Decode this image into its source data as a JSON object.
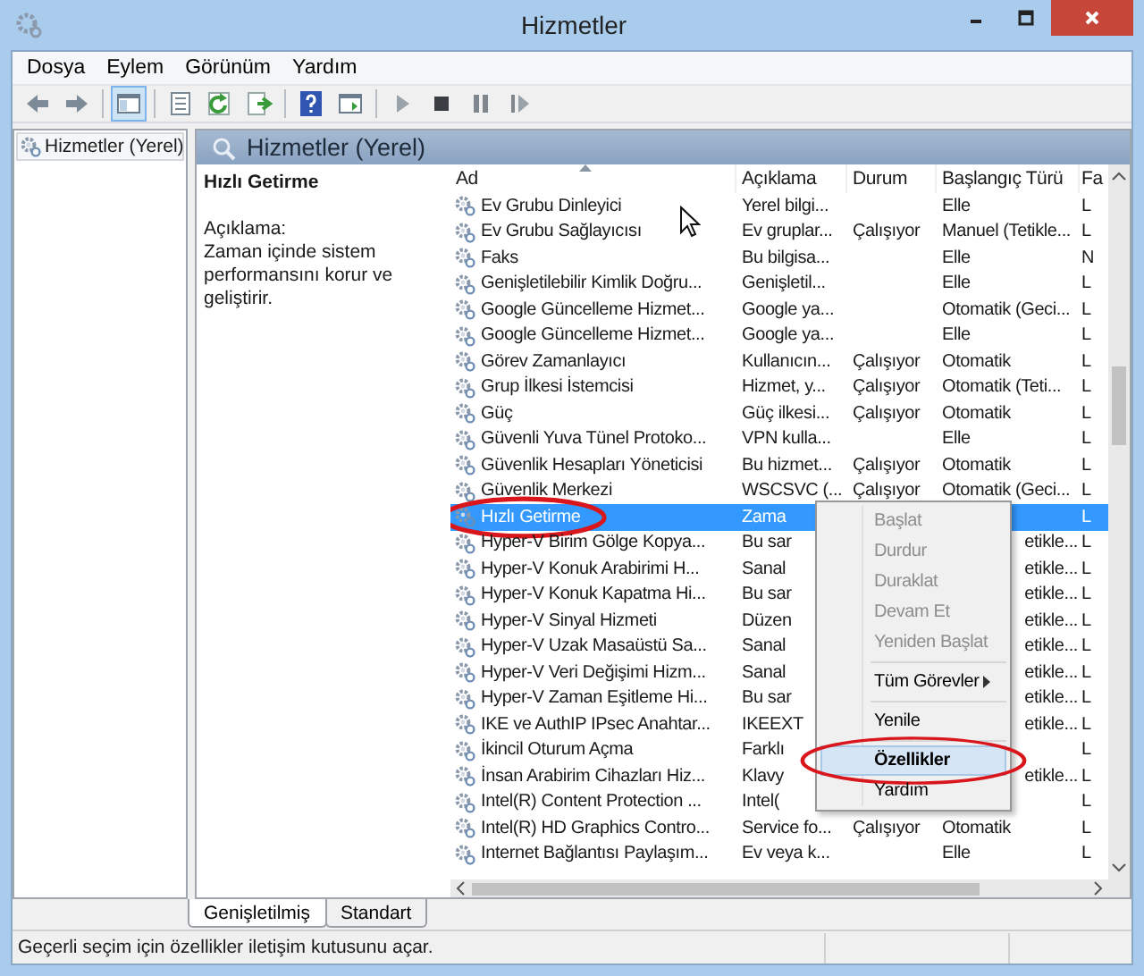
{
  "window": {
    "title": "Hizmetler"
  },
  "menu_bar": [
    "Dosya",
    "Eylem",
    "Görünüm",
    "Yardım"
  ],
  "toolbar": [
    {
      "kind": "back",
      "selected": false
    },
    {
      "kind": "forward",
      "selected": false
    },
    {
      "kind": "separator"
    },
    {
      "kind": "tree",
      "selected": true
    },
    {
      "kind": "separator"
    },
    {
      "kind": "properties",
      "selected": false
    },
    {
      "kind": "refresh",
      "selected": false
    },
    {
      "kind": "export",
      "selected": false
    },
    {
      "kind": "separator"
    },
    {
      "kind": "help",
      "selected": false
    },
    {
      "kind": "action",
      "selected": false
    },
    {
      "kind": "separator"
    },
    {
      "kind": "play",
      "selected": false
    },
    {
      "kind": "stop",
      "selected": false
    },
    {
      "kind": "pause",
      "selected": false
    },
    {
      "kind": "resume",
      "selected": false
    }
  ],
  "tree": [
    {
      "label": "Hizmetler (Yerel)",
      "selected": true
    }
  ],
  "panel": {
    "title": "Hizmetler (Yerel)",
    "service_name": "Hızlı Getirme",
    "description_label": "Açıklama:",
    "description": "Zaman içinde sistem performansını korur ve geliştirir."
  },
  "list": {
    "columns": [
      {
        "label": "Ad",
        "sorted": true
      },
      {
        "label": "Açıklama",
        "sorted": false
      },
      {
        "label": "Durum",
        "sorted": false
      },
      {
        "label": "Başlangıç Türü",
        "sorted": false
      },
      {
        "label": "Fa",
        "sorted": false
      }
    ],
    "rows": [
      {
        "kind": "plain",
        "name": "Ev Grubu Dinleyici",
        "description": "Yerel bilgi...",
        "startup": "Elle",
        "column_5": "L",
        "selected": false,
        "circled": false
      },
      {
        "kind": "plain",
        "name": "Ev Grubu Sağlayıcısı",
        "description": "Ev gruplar...",
        "status": "Çalışıyor",
        "startup": "Manuel (Tetikle...",
        "column_5": "L",
        "selected": false,
        "circled": false
      },
      {
        "kind": "plain",
        "name": "Faks",
        "description": "Bu bilgisa...",
        "startup": "Elle",
        "column_5": "N",
        "selected": false,
        "circled": false
      },
      {
        "kind": "plain",
        "name": "Genişletilebilir Kimlik Doğru...",
        "description": "Genişletil...",
        "startup": "Elle",
        "column_5": "L",
        "selected": false,
        "circled": false
      },
      {
        "kind": "plain",
        "name": "Google Güncelleme Hizmet...",
        "description": "Google ya...",
        "startup": "Otomatik (Geci...",
        "column_5": "L",
        "selected": false,
        "circled": false
      },
      {
        "kind": "plain",
        "name": "Google Güncelleme Hizmet...",
        "description": "Google ya...",
        "startup": "Elle",
        "column_5": "L",
        "selected": false,
        "circled": false
      },
      {
        "kind": "plain",
        "name": "Görev Zamanlayıcı",
        "description": "Kullanıcın...",
        "status": "Çalışıyor",
        "startup": "Otomatik",
        "column_5": "L",
        "selected": false,
        "circled": false
      },
      {
        "kind": "plain",
        "name": "Grup İlkesi İstemcisi",
        "description": "Hizmet, y...",
        "status": "Çalışıyor",
        "startup": "Otomatik (Teti...",
        "column_5": "L",
        "selected": false,
        "circled": false
      },
      {
        "kind": "plain",
        "name": "Güç",
        "description": "Güç ilkesi...",
        "status": "Çalışıyor",
        "startup": "Otomatik",
        "column_5": "L",
        "selected": false,
        "circled": false
      },
      {
        "kind": "plain",
        "name": "Güvenli Yuva Tünel Protoko...",
        "description": "VPN kulla...",
        "startup": "Elle",
        "column_5": "L",
        "selected": false,
        "circled": false
      },
      {
        "kind": "plain",
        "name": "Güvenlik Hesapları Yöneticisi",
        "description": "Bu hizmet...",
        "status": "Çalışıyor",
        "startup": "Otomatik",
        "column_5": "L",
        "selected": false,
        "circled": false
      },
      {
        "kind": "plain",
        "name": "Güvenlik Merkezi",
        "description": "WSCSVC (...",
        "status": "Çalışıyor",
        "startup": "Otomatik (Geci...",
        "column_5": "L",
        "selected": false,
        "circled": false
      },
      {
        "kind": "covered",
        "name": "Hızlı Getirme",
        "description": "Zama",
        "column_5": "L",
        "selected": true,
        "circled": true
      },
      {
        "kind": "covered",
        "name": "Hyper-V Birim Gölge Kopya...",
        "description": "Bu sar",
        "startup": "etikle...",
        "column_5": "L",
        "selected": false,
        "circled": false
      },
      {
        "kind": "covered",
        "name": "Hyper-V Konuk Arabirimi H...",
        "description": "Sanal",
        "startup": "etikle...",
        "column_5": "L",
        "selected": false,
        "circled": false
      },
      {
        "kind": "covered",
        "name": "Hyper-V Konuk Kapatma Hi...",
        "description": "Bu sar",
        "startup": "etikle...",
        "column_5": "L",
        "selected": false,
        "circled": false
      },
      {
        "kind": "covered",
        "name": "Hyper-V Sinyal Hizmeti",
        "description": "Düzen",
        "startup": "etikle...",
        "column_5": "L",
        "selected": false,
        "circled": false
      },
      {
        "kind": "covered",
        "name": "Hyper-V Uzak Masaüstü Sa...",
        "description": "Sanal",
        "startup": "etikle...",
        "column_5": "L",
        "selected": false,
        "circled": false
      },
      {
        "kind": "covered",
        "name": "Hyper-V Veri Değişimi Hizm...",
        "description": "Sanal",
        "startup": "etikle...",
        "column_5": "L",
        "selected": false,
        "circled": false
      },
      {
        "kind": "covered",
        "name": "Hyper-V Zaman Eşitleme Hi...",
        "description": "Bu sar",
        "startup": "etikle...",
        "column_5": "L",
        "selected": false,
        "circled": false
      },
      {
        "kind": "covered",
        "name": "IKE ve AuthIP IPsec Anahtar...",
        "description": "IKEEXT",
        "startup": "etikle...",
        "column_5": "L",
        "selected": false,
        "circled": false
      },
      {
        "kind": "covered",
        "name": "İkincil Oturum Açma",
        "description": "Farklı",
        "column_5": "L",
        "selected": false,
        "circled": false
      },
      {
        "kind": "covered",
        "name": "İnsan Arabirim Cihazları Hiz...",
        "description": "Klavy",
        "startup": "etikle...",
        "column_5": "L",
        "selected": false,
        "circled": false
      },
      {
        "kind": "covered",
        "name": "Intel(R) Content Protection ...",
        "description": "Intel(",
        "column_5": "L",
        "selected": false,
        "circled": false
      },
      {
        "kind": "plain",
        "name": "Intel(R) HD Graphics Contro...",
        "description": "Service fo...",
        "status": "Çalışıyor",
        "startup": "Otomatik",
        "column_5": "L",
        "selected": false,
        "circled": false
      },
      {
        "kind": "plain",
        "name": "Internet Bağlantısı Paylaşım...",
        "description": "Ev veya k...",
        "startup": "Elle",
        "column_5": "L",
        "selected": false,
        "circled": false
      }
    ]
  },
  "context_menu": [
    {
      "kind": "item",
      "label": "Başlat",
      "disabled": true,
      "selected": false,
      "circled": false
    },
    {
      "kind": "item",
      "label": "Durdur",
      "disabled": true,
      "selected": false,
      "circled": false
    },
    {
      "kind": "item",
      "label": "Duraklat",
      "disabled": true,
      "selected": false,
      "circled": false
    },
    {
      "kind": "item",
      "label": "Devam Et",
      "disabled": true,
      "selected": false,
      "circled": false
    },
    {
      "kind": "item",
      "label": "Yeniden Başlat",
      "disabled": true,
      "selected": false,
      "circled": false
    },
    {
      "kind": "separator"
    },
    {
      "kind": "submenu",
      "label": "Tüm Görevler",
      "disabled": false,
      "selected": false,
      "circled": false
    },
    {
      "kind": "separator"
    },
    {
      "kind": "item",
      "label": "Yenile",
      "disabled": false,
      "selected": false,
      "circled": false
    },
    {
      "kind": "separator"
    },
    {
      "kind": "item",
      "label": "Özellikler",
      "disabled": false,
      "selected": true,
      "circled": true
    },
    {
      "kind": "item",
      "label": "Yardım",
      "disabled": false,
      "selected": false,
      "circled": false
    }
  ],
  "view_tabs": [
    {
      "label": "Genişletilmiş",
      "selected": true
    },
    {
      "label": "Standart",
      "selected": false
    }
  ],
  "status_bar": {
    "text": "Geçerli seçim için özellikler iletişim kutusunu açar."
  }
}
